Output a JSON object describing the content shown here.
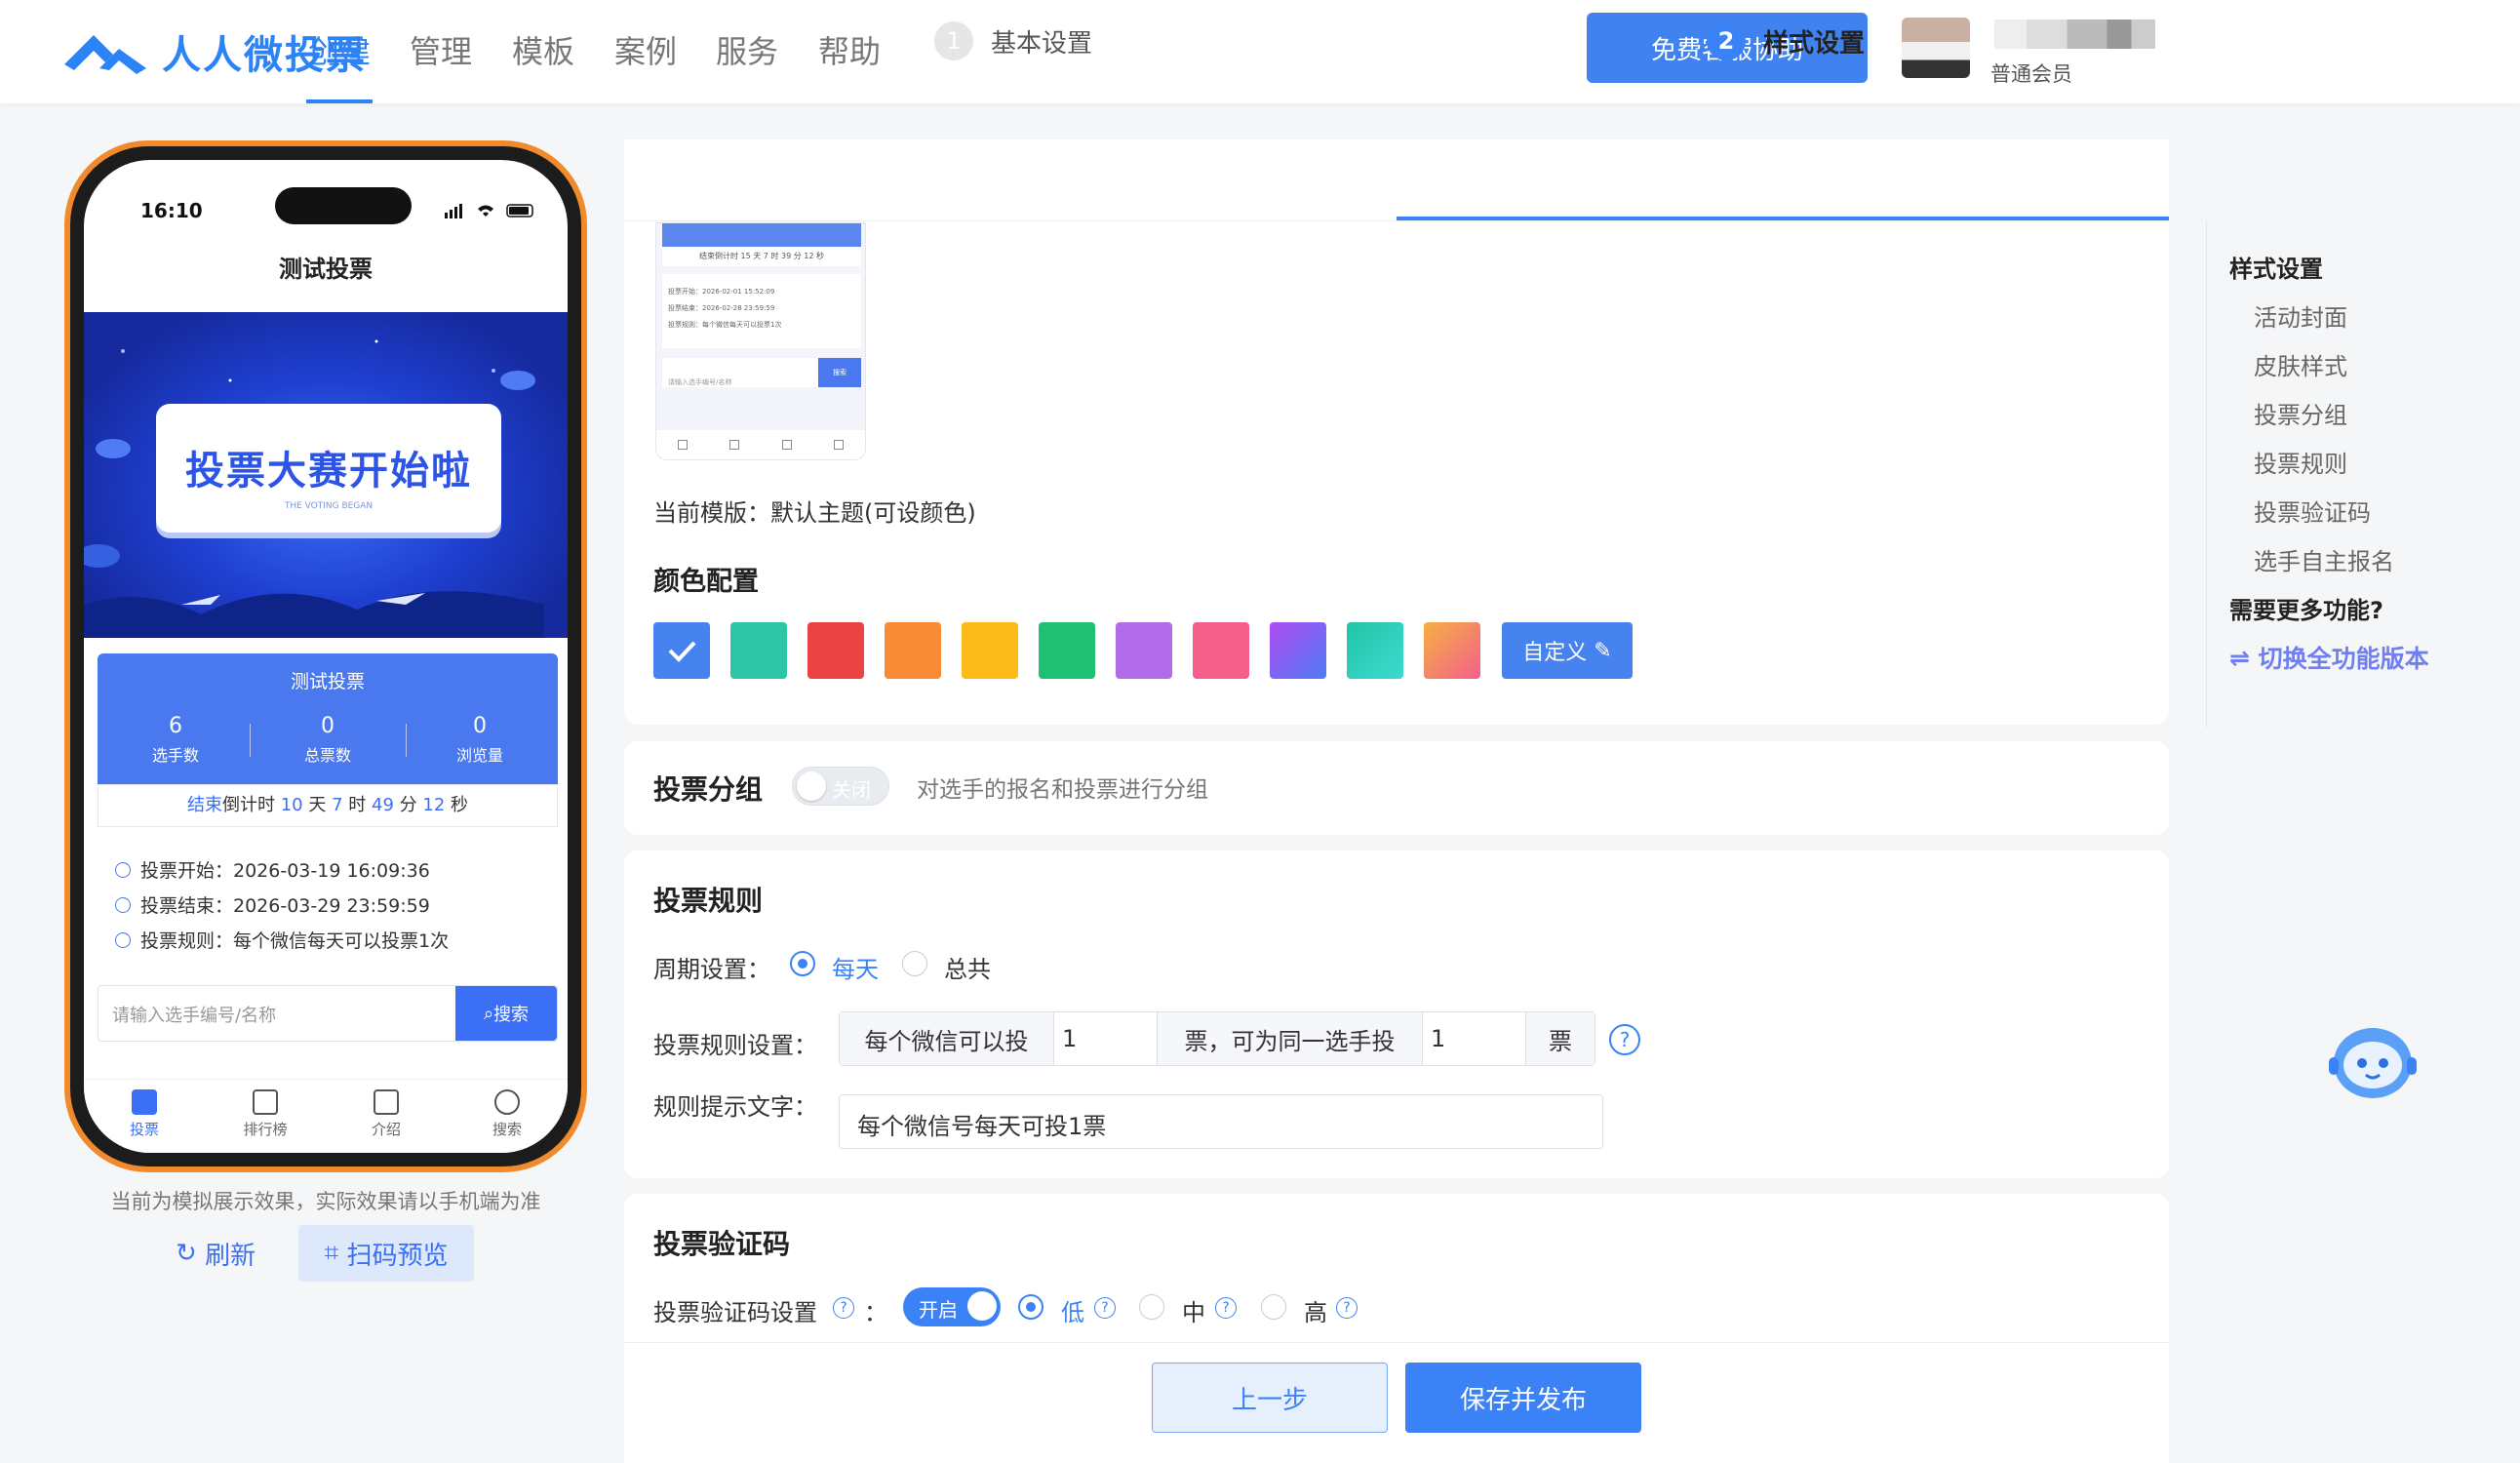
{
  "brand": {
    "name": "人人微投票",
    "color": "#2c83f5"
  },
  "nav": {
    "items": [
      "创建",
      "管理",
      "模板",
      "案例",
      "服务",
      "帮助"
    ],
    "active": "创建"
  },
  "header": {
    "help_button": "免费客服协助",
    "member_level": "普通会员"
  },
  "phone": {
    "time": "16:10",
    "title": "测试投票",
    "banner_title": "投票大赛开始啦",
    "banner_subtitle": "THE VOTING BEGAN",
    "stats_title": "测试投票",
    "stats": [
      {
        "value": "6",
        "label": "选手数"
      },
      {
        "value": "0",
        "label": "总票数"
      },
      {
        "value": "0",
        "label": "浏览量"
      }
    ],
    "countdown": {
      "prefix": "结束",
      "label": "倒计时",
      "days": "10",
      "d_unit": "天",
      "hours": "7",
      "h_unit": "时",
      "minutes": "49",
      "m_unit": "分",
      "seconds": "12",
      "s_unit": "秒"
    },
    "info": [
      "投票开始：2026-03-19 16:09:36",
      "投票结束：2026-03-29 23:59:59",
      "投票规则：每个微信每天可以投票1次"
    ],
    "search_placeholder": "请输入选手编号/名称",
    "search_button": "搜索",
    "tabs": [
      "投票",
      "排行榜",
      "介绍",
      "搜索"
    ],
    "active_tab": "投票"
  },
  "preview": {
    "note": "当前为模拟展示效果，实际效果请以手机端为准",
    "refresh": "刷新",
    "scan": "扫码预览"
  },
  "steps": [
    {
      "num": "1",
      "label": "基本设置"
    },
    {
      "num": "2",
      "label": "样式设置"
    }
  ],
  "thumb": {
    "countdown": "结束倒计时 15 天 7 时 39 分 12 秒",
    "info": [
      "投票开始：2026-02-01 15:52:09",
      "投票结束：2026-02-28 23:59:59",
      "投票规则：每个微信每天可以投票1次"
    ],
    "search_placeholder": "请输入选手编号/名称",
    "search_button": "搜索"
  },
  "style": {
    "template_label": "当前模版：默认主题(可设颜色)",
    "color_title": "颜色配置",
    "colors": [
      "#4683ef",
      "#2ec4a6",
      "#e94343",
      "#f98a36",
      "#fdbb1a",
      "#1fbf74",
      "#b26cea",
      "#f45f8c",
      "linear-gradient(135deg,#b14cf3,#4f7cf4)",
      "linear-gradient(135deg,#22c5a6,#3cd9d0)",
      "linear-gradient(135deg,#f5b042,#f45f8c)"
    ],
    "selected_color": 0,
    "custom_label": "自定义"
  },
  "grouping": {
    "title": "投票分组",
    "toggle": "关闭",
    "desc": "对选手的报名和投票进行分组"
  },
  "rules": {
    "title": "投票规则",
    "period_label": "周期设置：",
    "period_options": [
      "每天",
      "总共"
    ],
    "period_selected": "每天",
    "rule_label": "投票规则设置：",
    "rule_prefix": "每个微信可以投",
    "rule_value1": "1",
    "rule_mid": "票，可为同一选手投",
    "rule_value2": "1",
    "rule_suffix": "票",
    "hint_label": "规则提示文字：",
    "hint_value": "每个微信号每天可投1票"
  },
  "captcha": {
    "title": "投票验证码",
    "label": "投票验证码设置",
    "colon": "：",
    "toggle": "开启",
    "levels": [
      "低",
      "中",
      "高"
    ],
    "selected": "低"
  },
  "footer": {
    "prev": "上一步",
    "save": "保存并发布"
  },
  "sidebar": {
    "title": "样式设置",
    "items": [
      "活动封面",
      "皮肤样式",
      "投票分组",
      "投票规则",
      "投票验证码",
      "选手自主报名"
    ],
    "more": "需要更多功能?",
    "switch": "切换全功能版本"
  }
}
